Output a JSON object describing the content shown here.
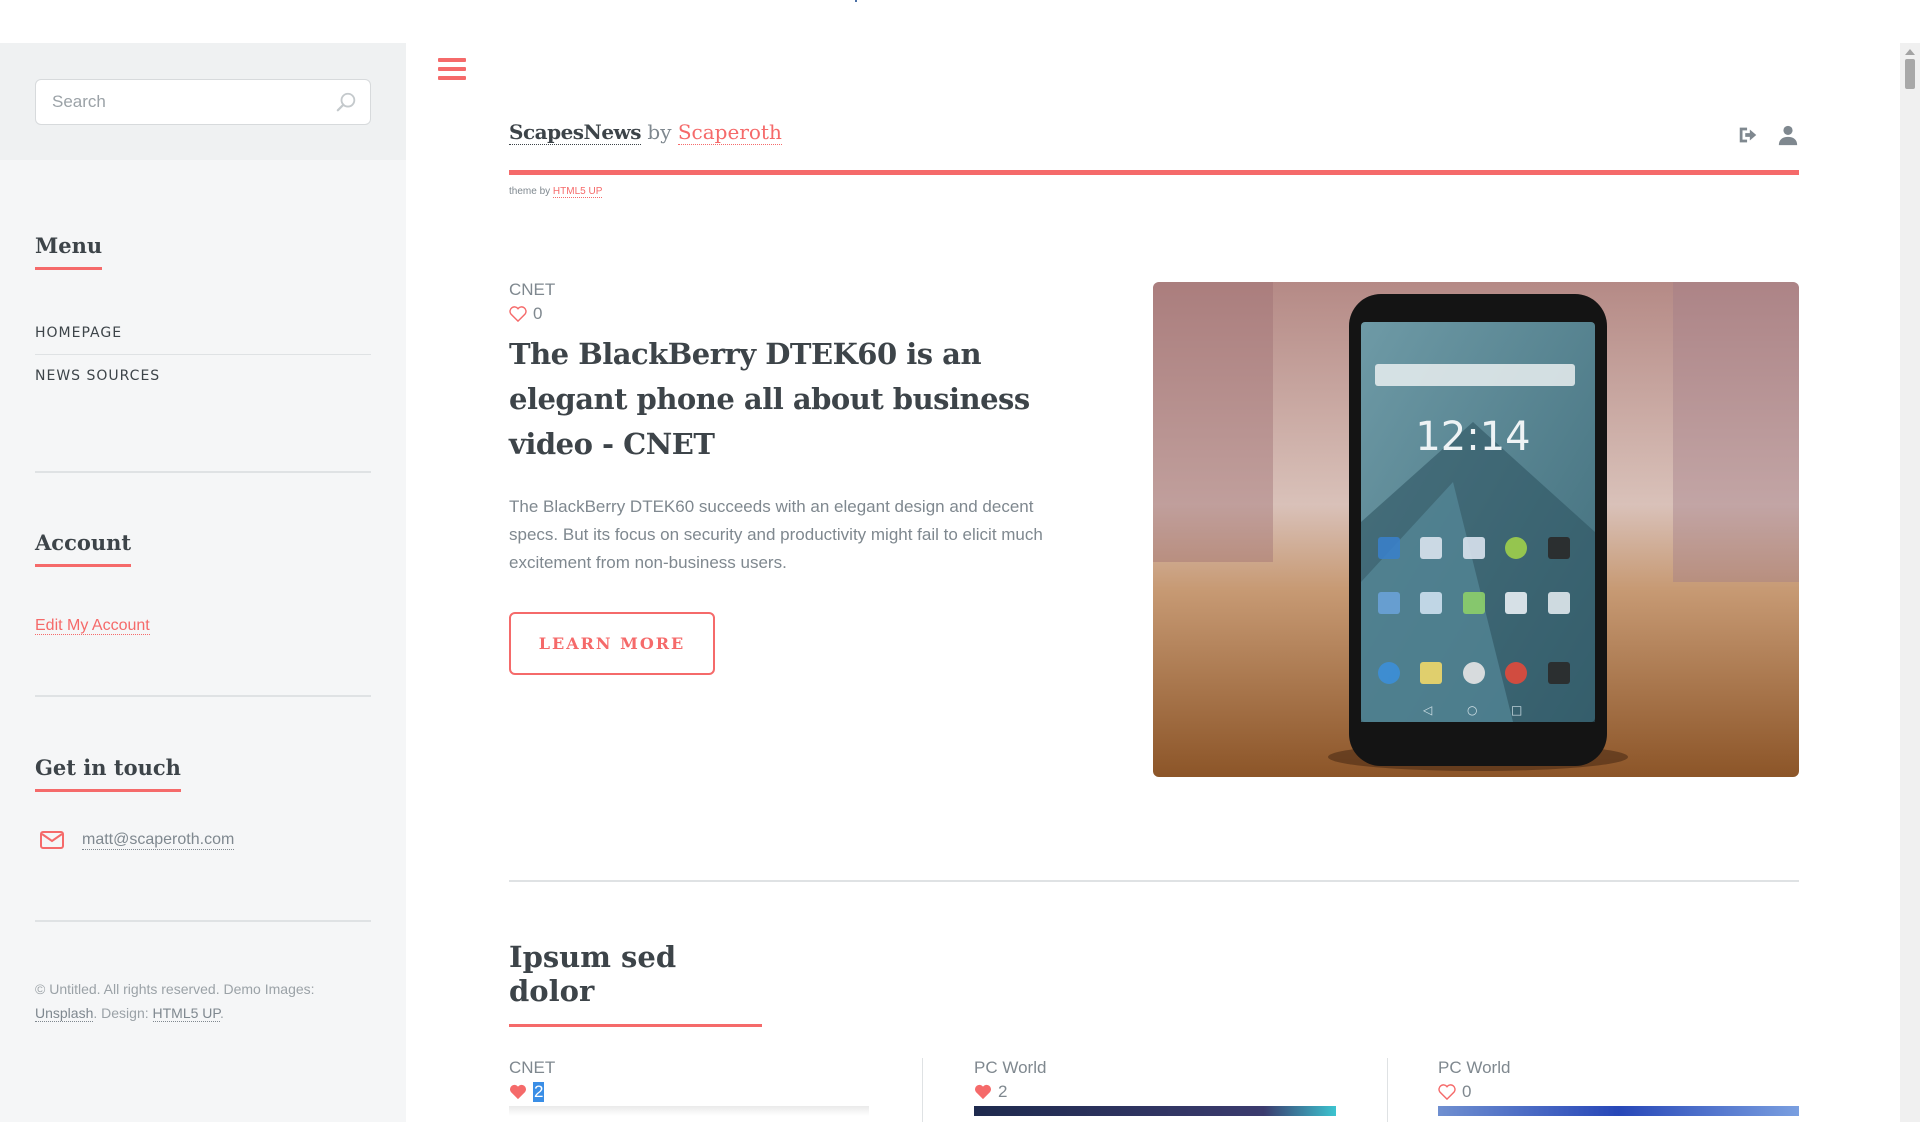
{
  "sidebar": {
    "search_placeholder": "Search",
    "menu_heading": "Menu",
    "menu_items": [
      "HOMEPAGE",
      "NEWS SOURCES"
    ],
    "account_heading": "Account",
    "account_link": "Edit My Account",
    "contact_heading": "Get in touch",
    "contact_email": "matt@scaperoth.com",
    "copyright": {
      "prefix": "© Untitled. All rights reserved. Demo Images:",
      "unsplash": "Unsplash",
      "design_label": ". Design:",
      "html5up": "HTML5 UP",
      "suffix": "."
    }
  },
  "header": {
    "brand_name": "ScapesNews",
    "by": "by",
    "author": "Scaperoth",
    "theme_prefix": "theme by",
    "theme_link": "HTML5 UP",
    "icons": [
      "sign-out-icon",
      "user-icon"
    ]
  },
  "feature": {
    "source": "CNET",
    "likes": "0",
    "title": "The BlackBerry DTEK60 is an elegant phone all about business video - CNET",
    "description": "The BlackBerry DTEK60 succeeds with an elegant design and decent specs. But its focus on security and productivity might fail to elicit much excitement from non-business users.",
    "button": "LEARN MORE",
    "phone_time": "12:14"
  },
  "section": {
    "heading": "Ipsum sed dolor"
  },
  "cards": [
    {
      "source": "CNET",
      "likes": "2",
      "liked": true
    },
    {
      "source": "PC World",
      "likes": "2",
      "liked": true
    },
    {
      "source": "PC World",
      "likes": "0",
      "liked": false
    }
  ],
  "colors": {
    "accent": "#f56a6a",
    "heading": "#3d4449",
    "text": "#7f888f",
    "sidebar_bg": "#f5f6f7"
  }
}
